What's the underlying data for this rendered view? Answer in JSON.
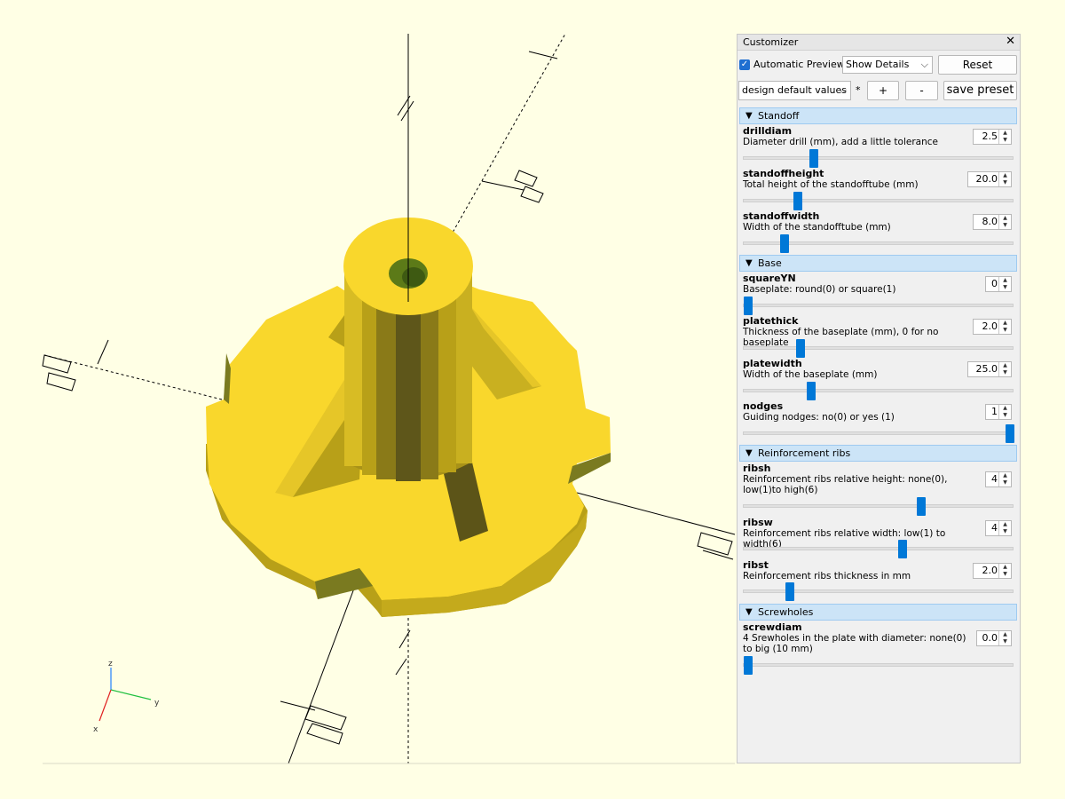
{
  "panel": {
    "title": "Customizer",
    "close_glyph": "✕",
    "auto_preview_label": "Automatic Preview",
    "auto_preview_checked": true,
    "details_select": "Show Details",
    "reset_label": "Reset",
    "preset_select": "design default values",
    "preset_modified_marker": "*",
    "add_label": "+",
    "remove_label": "-",
    "save_preset_label": "save preset"
  },
  "groups": [
    {
      "title": "Standoff",
      "params": [
        {
          "name": "drilldiam",
          "desc": "Diameter drill (mm), add a little tolerance",
          "value": "2.5",
          "slider": 0.25
        },
        {
          "name": "standoffheight",
          "desc": "Total height of the  standofftube (mm)",
          "value": "20.0",
          "slider": 0.19
        },
        {
          "name": "standoffwidth",
          "desc": "Width of the standofftube (mm)",
          "value": "8.0",
          "slider": 0.14
        }
      ]
    },
    {
      "title": "Base",
      "params": [
        {
          "name": "squareYN",
          "desc": "Baseplate: round(0) or square(1)",
          "value": "0",
          "slider": 0.0
        },
        {
          "name": "platethick",
          "desc": "Thickness of the baseplate (mm), 0 for no baseplate",
          "value": "2.0",
          "slider": 0.2
        },
        {
          "name": "platewidth",
          "desc": "Width of the baseplate (mm)",
          "value": "25.0",
          "slider": 0.24
        },
        {
          "name": "nodges",
          "desc": "Guiding nodges: no(0) or yes (1)",
          "value": "1",
          "slider": 1.0
        }
      ]
    },
    {
      "title": "Reinforcement ribs",
      "params": [
        {
          "name": "ribsh",
          "desc": "Reinforcement ribs relative height: none(0), low(1)to high(6)",
          "value": "4",
          "slider": 0.66
        },
        {
          "name": "ribsw",
          "desc": "Reinforcement ribs relative width: low(1) to width(6)",
          "value": "4",
          "slider": 0.59
        },
        {
          "name": "ribst",
          "desc": "Reinforcement ribs thickness in mm",
          "value": "2.0",
          "slider": 0.16
        }
      ]
    },
    {
      "title": "Screwholes",
      "params": [
        {
          "name": "screwdiam",
          "desc": "4 Srewholes in the plate with diameter: none(0) to big (10 mm)",
          "value": "0.0",
          "slider": 0.0
        }
      ]
    }
  ],
  "axes": {
    "x": "x",
    "y": "y",
    "z": "z"
  },
  "colors": {
    "background": "#ffffe5",
    "model_top": "#f9d72c",
    "model_side": "#b8a018",
    "model_shadow": "#7a7a20",
    "accent": "#0078d7"
  }
}
